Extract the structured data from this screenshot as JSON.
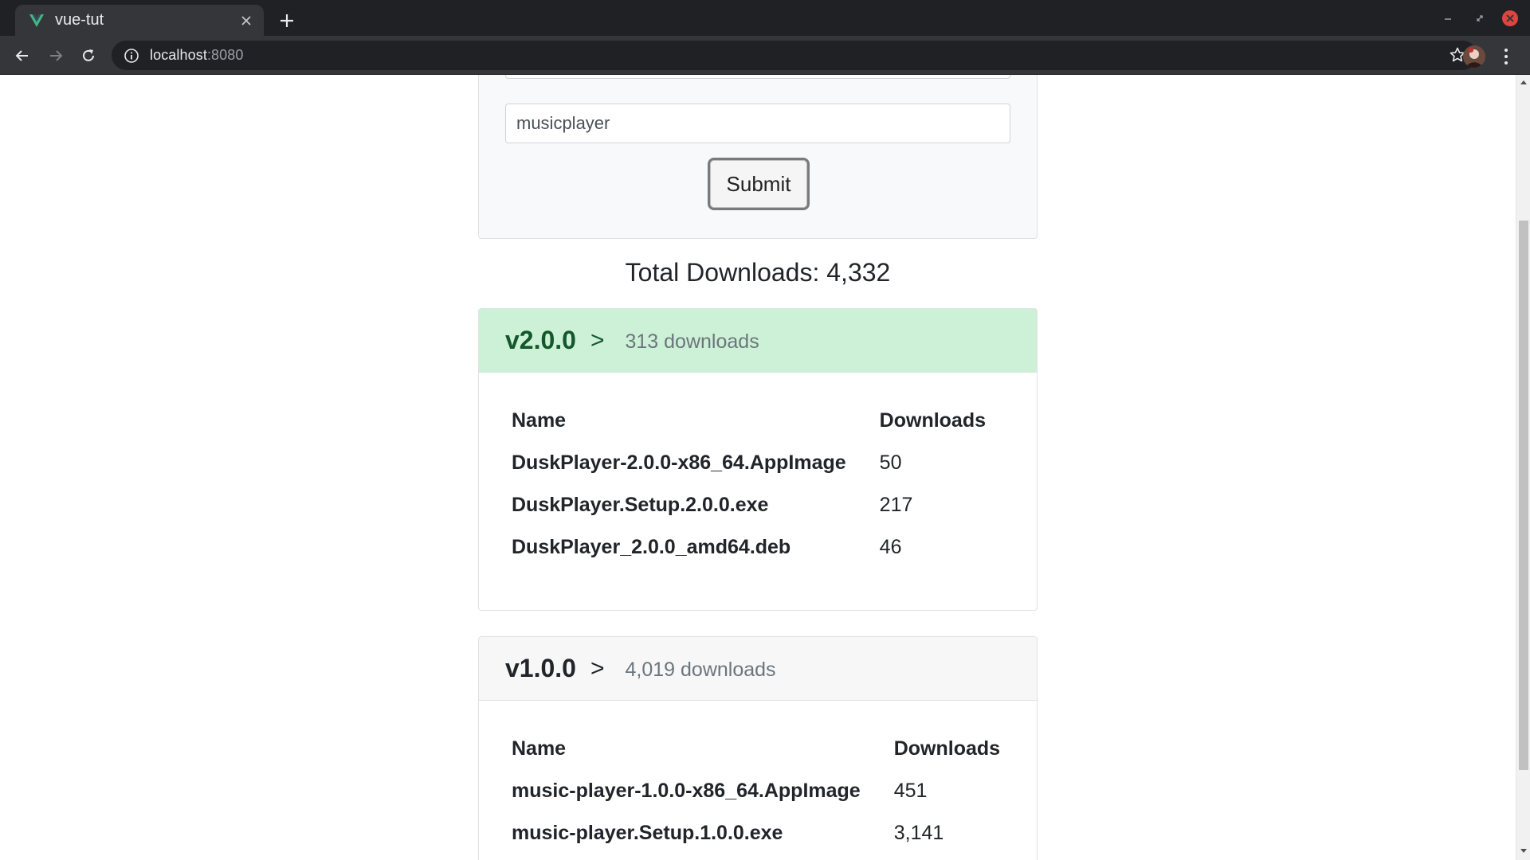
{
  "browser": {
    "tab_title": "vue-tut",
    "url_host": "localhost",
    "url_port": ":8080"
  },
  "form": {
    "input_value": "musicplayer",
    "submit_label": "Submit"
  },
  "total_downloads": "Total Downloads: 4,332",
  "releases": [
    {
      "version": "v2.0.0",
      "arrow": ">",
      "downloads_text": "313 downloads",
      "latest": true,
      "columns": [
        "Name",
        "Downloads"
      ],
      "assets": [
        {
          "name": "DuskPlayer-2.0.0-x86_64.AppImage",
          "downloads": "50"
        },
        {
          "name": "DuskPlayer.Setup.2.0.0.exe",
          "downloads": "217"
        },
        {
          "name": "DuskPlayer_2.0.0_amd64.deb",
          "downloads": "46"
        }
      ]
    },
    {
      "version": "v1.0.0",
      "arrow": ">",
      "downloads_text": "4,019 downloads",
      "latest": false,
      "columns": [
        "Name",
        "Downloads"
      ],
      "assets": [
        {
          "name": "music-player-1.0.0-x86_64.AppImage",
          "downloads": "451"
        },
        {
          "name": "music-player.Setup.1.0.0.exe",
          "downloads": "3,141"
        }
      ]
    }
  ],
  "colors": {
    "latest_header_bg": "#cdf1d7",
    "latest_header_text": "#13572a",
    "vue_green": "#41b883"
  }
}
